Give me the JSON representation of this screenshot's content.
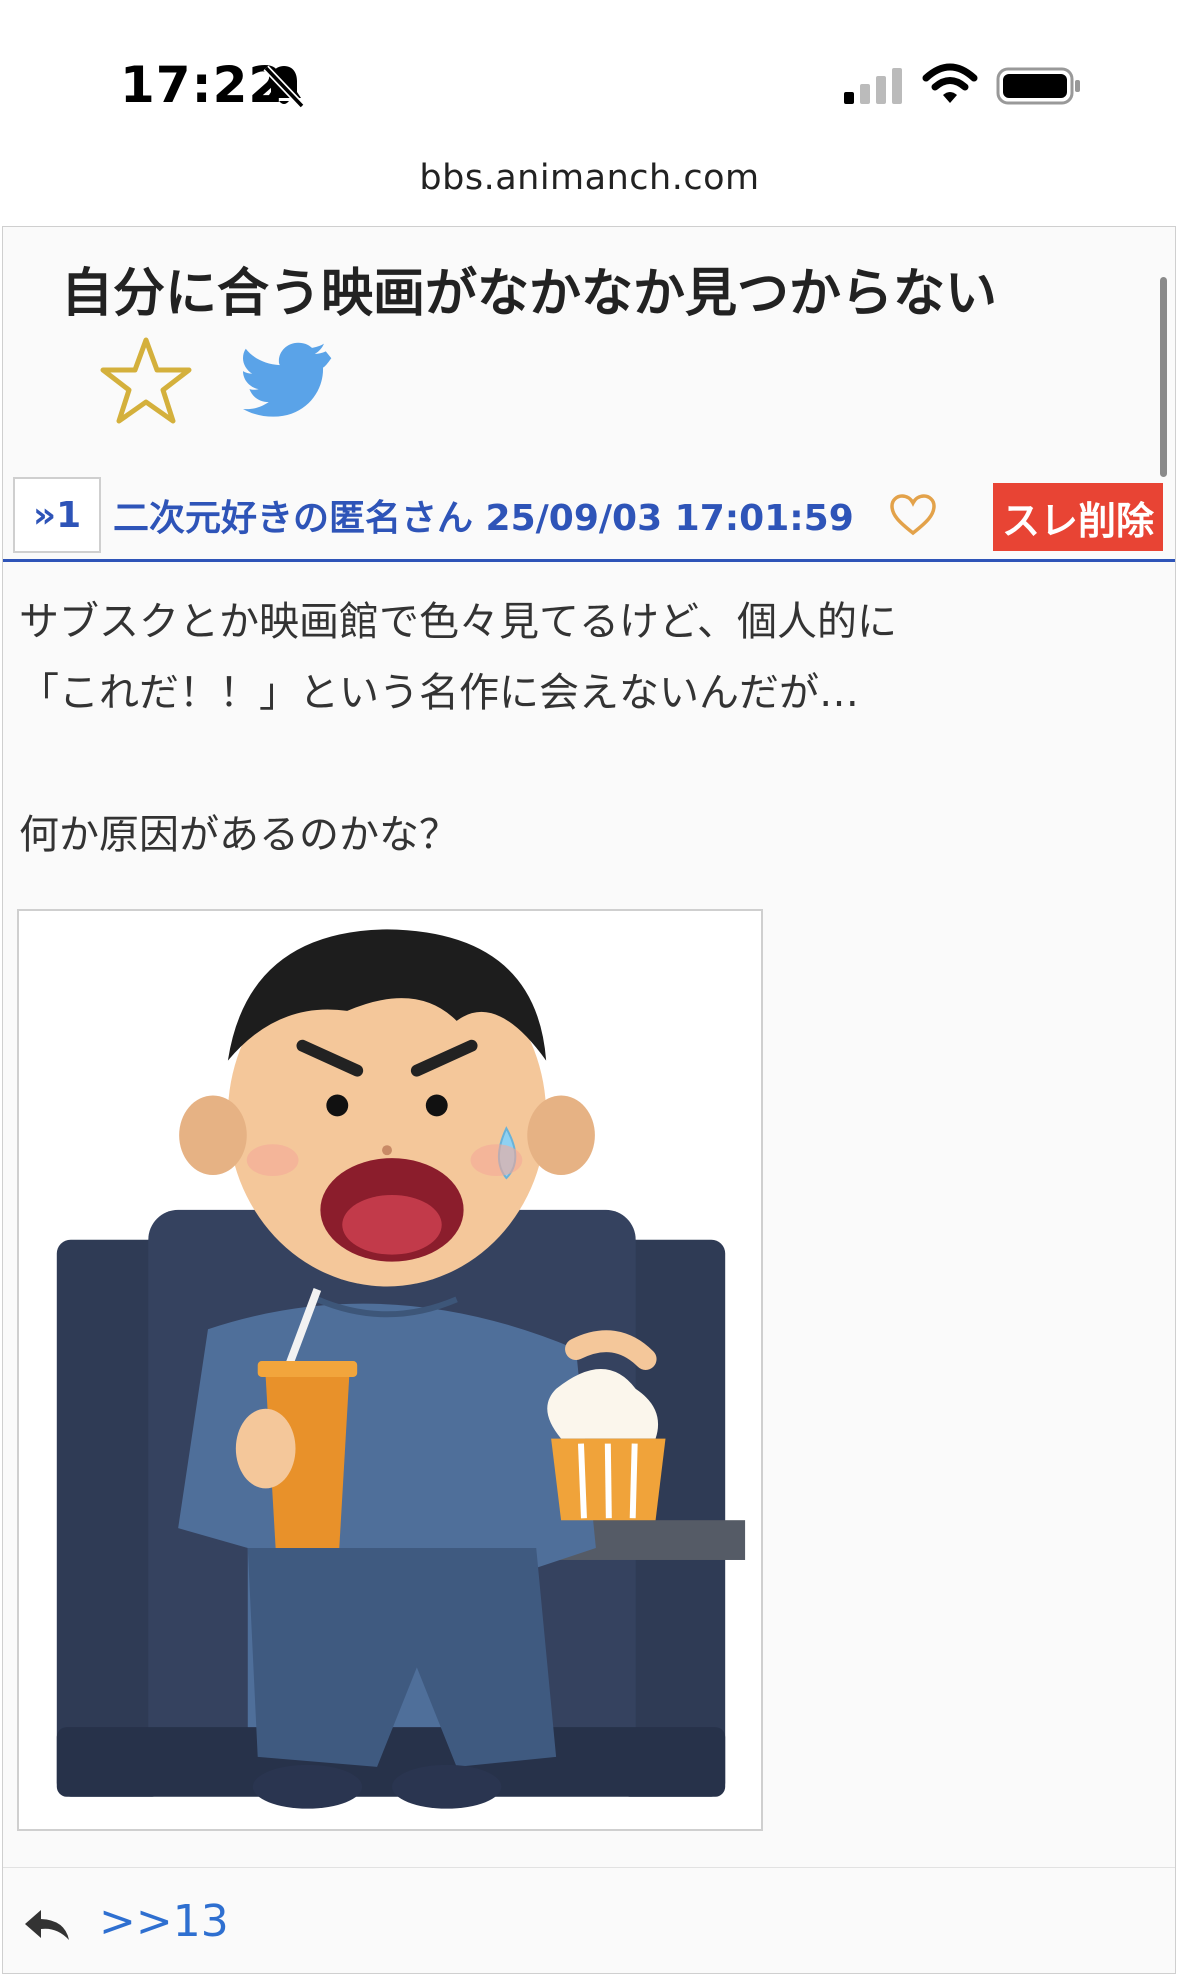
{
  "status_bar": {
    "time": "17:22"
  },
  "browser": {
    "url": "bbs.animanch.com"
  },
  "thread": {
    "title": "自分に合う映画がなかなか見つからない",
    "post": {
      "number": "»1",
      "meta": "二次元好きの匿名さん 25/09/03 17:01:59",
      "delete_label": "スレ削除",
      "body_lines": [
        "サブスクとか映画館で色々見てるけど、個人的に",
        "「これだ！！」という名作に会えないんだが…",
        "",
        "何か原因があるのかな？"
      ],
      "reply_count_link": ">>13"
    }
  },
  "colors": {
    "accent": "#2e54b8",
    "delete": "#e84434",
    "star": "#d4b03c",
    "twitter": "#5aa3e8",
    "heart": "#e3a24a"
  },
  "icons": [
    "bell-slash-icon",
    "signal-icon",
    "wifi-icon",
    "battery-icon",
    "star-icon",
    "twitter-icon",
    "heart-icon",
    "reply-icon"
  ]
}
